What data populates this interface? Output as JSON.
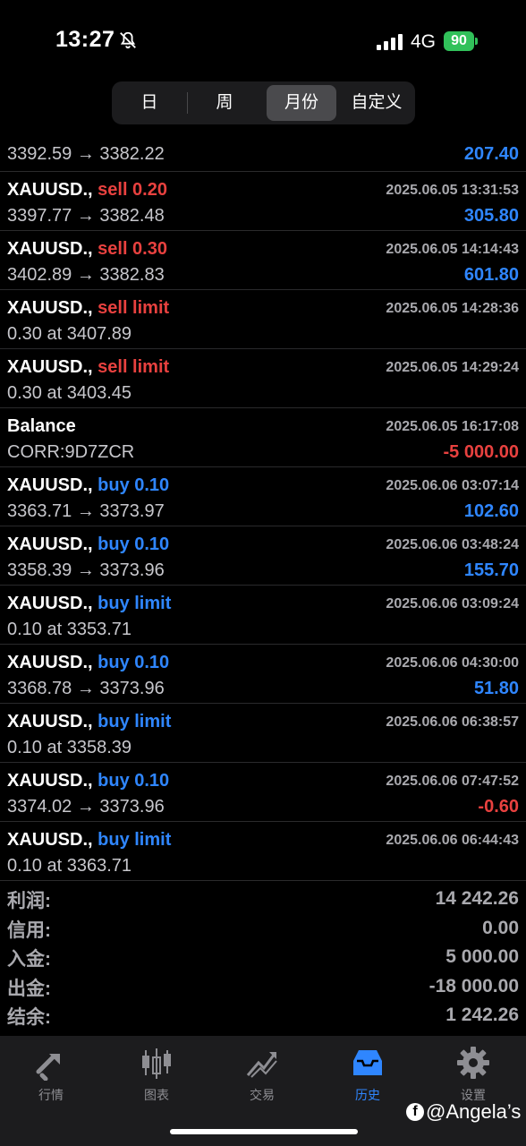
{
  "status_bar": {
    "time": "13:27",
    "network": "4G",
    "battery": "90"
  },
  "segments": [
    {
      "label": "日",
      "active": false
    },
    {
      "label": "周",
      "active": false
    },
    {
      "label": "月份",
      "active": true
    },
    {
      "label": "自定义",
      "active": false
    }
  ],
  "partial_row": {
    "price_line": "3392.59 → 3382.22",
    "amount": "207.40"
  },
  "rows": [
    {
      "symbol": "XAUUSD.,",
      "action": "sell 0.20",
      "type": "sell",
      "date": "2025.06.05 13:31:53",
      "detail": "3397.77 → 3382.48",
      "amount": "305.80",
      "sign": "pos"
    },
    {
      "symbol": "XAUUSD.,",
      "action": "sell 0.30",
      "type": "sell",
      "date": "2025.06.05 14:14:43",
      "detail": "3402.89 → 3382.83",
      "amount": "601.80",
      "sign": "pos"
    },
    {
      "symbol": "XAUUSD.,",
      "action": "sell limit",
      "type": "sell",
      "date": "2025.06.05 14:28:36",
      "detail": "0.30 at 3407.89",
      "amount": "",
      "sign": "pos"
    },
    {
      "symbol": "XAUUSD.,",
      "action": "sell limit",
      "type": "sell",
      "date": "2025.06.05 14:29:24",
      "detail": "0.30 at 3403.45",
      "amount": "",
      "sign": "pos"
    },
    {
      "symbol": "Balance",
      "action": "",
      "type": "none",
      "date": "2025.06.05 16:17:08",
      "detail": "CORR:9D7ZCR",
      "amount": "-5 000.00",
      "sign": "neg"
    },
    {
      "symbol": "XAUUSD.,",
      "action": "buy 0.10",
      "type": "buy",
      "date": "2025.06.06 03:07:14",
      "detail": "3363.71 → 3373.97",
      "amount": "102.60",
      "sign": "pos"
    },
    {
      "symbol": "XAUUSD.,",
      "action": "buy 0.10",
      "type": "buy",
      "date": "2025.06.06 03:48:24",
      "detail": "3358.39 → 3373.96",
      "amount": "155.70",
      "sign": "pos"
    },
    {
      "symbol": "XAUUSD.,",
      "action": "buy limit",
      "type": "buy",
      "date": "2025.06.06 03:09:24",
      "detail": "0.10 at 3353.71",
      "amount": "",
      "sign": "pos"
    },
    {
      "symbol": "XAUUSD.,",
      "action": "buy 0.10",
      "type": "buy",
      "date": "2025.06.06 04:30:00",
      "detail": "3368.78 → 3373.96",
      "amount": "51.80",
      "sign": "pos"
    },
    {
      "symbol": "XAUUSD.,",
      "action": "buy limit",
      "type": "buy",
      "date": "2025.06.06 06:38:57",
      "detail": "0.10 at 3358.39",
      "amount": "",
      "sign": "pos"
    },
    {
      "symbol": "XAUUSD.,",
      "action": "buy 0.10",
      "type": "buy",
      "date": "2025.06.06 07:47:52",
      "detail": "3374.02 → 3373.96",
      "amount": "-0.60",
      "sign": "neg"
    },
    {
      "symbol": "XAUUSD.,",
      "action": "buy limit",
      "type": "buy",
      "date": "2025.06.06 06:44:43",
      "detail": "0.10 at 3363.71",
      "amount": "",
      "sign": "pos"
    }
  ],
  "summary": [
    {
      "label": "利润:",
      "value": "14 242.26"
    },
    {
      "label": "信用:",
      "value": "0.00"
    },
    {
      "label": "入金:",
      "value": "5 000.00"
    },
    {
      "label": "出金:",
      "value": "-18 000.00"
    },
    {
      "label": "结余:",
      "value": "1 242.26"
    }
  ],
  "tabs": [
    {
      "label": "行情",
      "icon": "quotes-icon",
      "active": false
    },
    {
      "label": "图表",
      "icon": "chart-icon",
      "active": false
    },
    {
      "label": "交易",
      "icon": "trade-icon",
      "active": false
    },
    {
      "label": "历史",
      "icon": "history-icon",
      "active": true
    },
    {
      "label": "设置",
      "icon": "settings-icon",
      "active": false
    }
  ],
  "watermark": "@Angela’s",
  "colors": {
    "sell": "#e8413f",
    "buy": "#2f86ff",
    "accent": "#2f86ff",
    "battery": "#31c15a"
  }
}
